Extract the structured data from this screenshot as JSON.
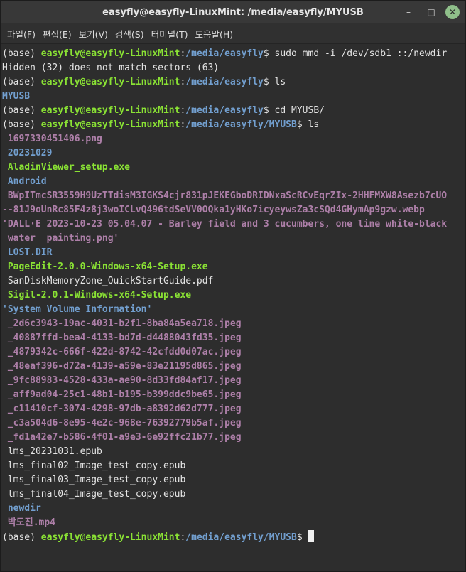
{
  "window": {
    "title": "easyfly@easyfly-LinuxMint: /media/easyfly/MYUSB",
    "controls": {
      "minimize": "–",
      "maximize": "□",
      "close": "✕"
    }
  },
  "menubar": {
    "items": [
      "파일(F)",
      "편집(E)",
      "보기(V)",
      "검색(S)",
      "터미널(T)",
      "도움말(H)"
    ]
  },
  "terminal": {
    "prompt": {
      "env": "(base) ",
      "userhost": "easyfly@easyfly-LinuxMint",
      "colon": ":",
      "path1": "/media/easyfly",
      "path2": "/media/easyfly/MYUSB",
      "dollar": "$ "
    },
    "cmd_mmd": "sudo mmd -i /dev/sdb1 ::/newdir",
    "out_hidden": "Hidden (32) does not match sectors (63)",
    "cmd_ls": "ls",
    "out_myusb": "MYUSB",
    "cmd_cd": "cd MYUSB/",
    "files": [
      {
        "text": " 1697330451406.png",
        "cls": "img"
      },
      {
        "text": " 20231029",
        "cls": "dir"
      },
      {
        "text": " AladinViewer_setup.exe",
        "cls": "exe"
      },
      {
        "text": " Android",
        "cls": "dir"
      },
      {
        "text": " BWpITmcSR3559H9UzTTdisM3IGKS4cjr831pJEKEGboDRIDNxaScRCvEqrZIx-2HHFMXW8Asezb7cUO",
        "cls": "img"
      },
      {
        "text": "--81J9oUnRc85F4z8j3woICLvQ496tdSeVV0OQka1yHKo7icyeywsZa3cSQd4GHymAp9gzw.webp",
        "cls": "img"
      },
      {
        "text": "'DALL·E 2023-10-23 05.04.07 - Barley field and 3 cucumbers, one line white-black",
        "cls": "img"
      },
      {
        "text": " water  painting.png'",
        "cls": "img"
      },
      {
        "text": " LOST.DIR",
        "cls": "dir"
      },
      {
        "text": " PageEdit-2.0.0-Windows-x64-Setup.exe",
        "cls": "exe"
      },
      {
        "text": " SanDiskMemoryZone_QuickStartGuide.pdf",
        "cls": "plain"
      },
      {
        "text": " Sigil-2.0.1-Windows-x64-Setup.exe",
        "cls": "exe"
      },
      {
        "text": "'System Volume Information'",
        "cls": "dir"
      },
      {
        "text": " _2d6c3943-19ac-4031-b2f1-8ba84a5ea718.jpeg",
        "cls": "img"
      },
      {
        "text": " _40887ffd-bea4-4133-bd7d-d4488043fd35.jpeg",
        "cls": "img"
      },
      {
        "text": " _4879342c-666f-422d-8742-42cfdd0d07ac.jpeg",
        "cls": "img"
      },
      {
        "text": " _48eaf396-d72a-4139-a59e-83e21195d865.jpeg",
        "cls": "img"
      },
      {
        "text": " _9fc88983-4528-433a-ae90-8d33fd84af17.jpeg",
        "cls": "img"
      },
      {
        "text": " _aff9ad04-25c1-48b1-b195-b399ddc9be65.jpeg",
        "cls": "img"
      },
      {
        "text": " _c11410cf-3074-4298-97db-a8392d62d777.jpeg",
        "cls": "img"
      },
      {
        "text": " _c3a504d6-8e95-4e2c-968e-76392779b5af.jpeg",
        "cls": "img"
      },
      {
        "text": " _fd1a42e7-b586-4f01-a9e3-6e92ffc21b77.jpeg",
        "cls": "img"
      },
      {
        "text": " lms_20231031.epub",
        "cls": "plain"
      },
      {
        "text": " lms_final02_Image_test_copy.epub",
        "cls": "plain"
      },
      {
        "text": " lms_final03_Image_test_copy.epub",
        "cls": "plain"
      },
      {
        "text": " lms_final04_Image_test_copy.epub",
        "cls": "plain"
      },
      {
        "text": " newdir",
        "cls": "dir"
      },
      {
        "text": " 박도진.mp4",
        "cls": "img"
      }
    ]
  }
}
